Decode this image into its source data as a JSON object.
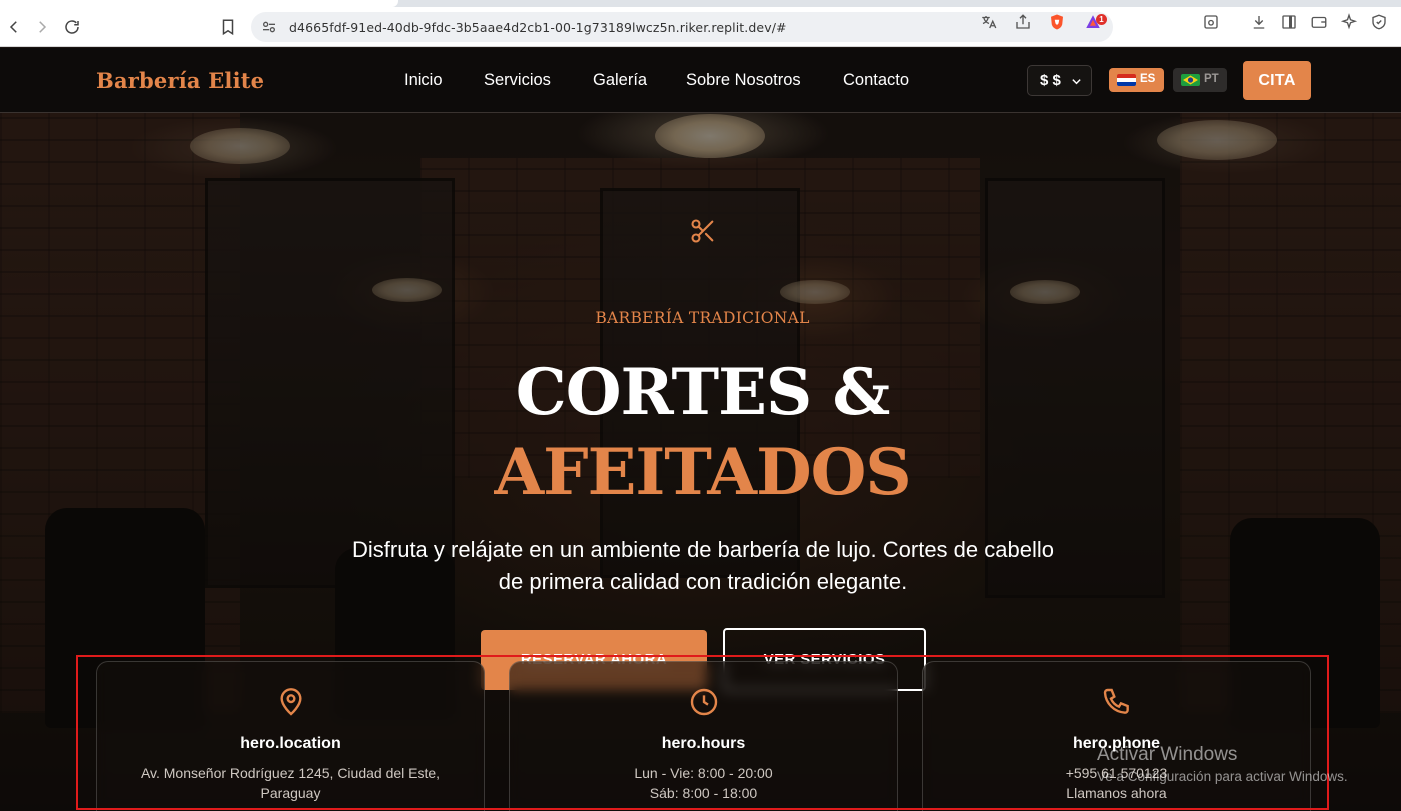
{
  "browser": {
    "url": "d4665fdf-91ed-40db-9fdc-3b5aae4d2cb1-00-1g73189lwcz5n.riker.replit.dev/#",
    "extension_badge": "1"
  },
  "nav": {
    "logo": "Barbería Elite",
    "links": [
      "Inicio",
      "Servicios",
      "Galería",
      "Sobre Nosotros",
      "Contacto"
    ],
    "currency": "$ $",
    "languages": [
      {
        "code": "ES",
        "active": true
      },
      {
        "code": "PT",
        "active": false
      }
    ],
    "cta": "CITA"
  },
  "hero": {
    "eyebrow": "BARBERÍA TRADICIONAL",
    "title_line1": "CORTES &",
    "title_line2": "AFEITADOS",
    "lead": "Disfruta y relájate en un ambiente de barbería de lujo. Cortes de cabello de primera calidad con tradición elegante.",
    "primary_button": "RESERVAR AHORA",
    "secondary_button": "VER SERVICIOS"
  },
  "info_cards": [
    {
      "icon": "map-pin-icon",
      "title": "hero.location",
      "line1": "Av. Monseñor Rodríguez 1245, Ciudad del Este,",
      "line2": "Paraguay"
    },
    {
      "icon": "clock-icon",
      "title": "hero.hours",
      "line1": "Lun - Vie: 8:00 - 20:00",
      "line2": "Sáb: 8:00 - 18:00"
    },
    {
      "icon": "phone-icon",
      "title": "hero.phone",
      "line1": "+595 61 570123",
      "line2": "Llamanos ahora"
    }
  ],
  "watermark": {
    "line1": "Activar Windows",
    "line2": "Ve a Configuración para activar Windows."
  },
  "colors": {
    "accent": "#e3854a",
    "nav_bg": "#0d0b0a",
    "highlight_box": "#e01b1b"
  }
}
